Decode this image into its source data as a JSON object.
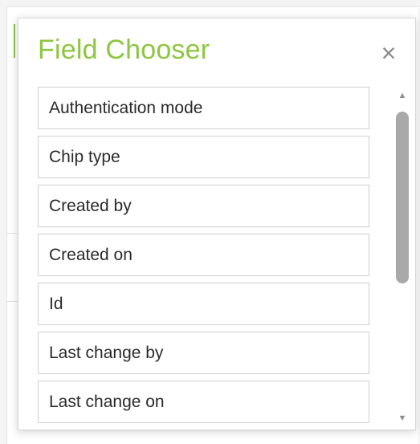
{
  "dialog": {
    "title": "Field Chooser",
    "close_glyph": "×",
    "accent_color": "#8dc63f"
  },
  "fields": [
    {
      "label": "Authentication mode"
    },
    {
      "label": "Chip type"
    },
    {
      "label": "Created by"
    },
    {
      "label": "Created on"
    },
    {
      "label": "Id"
    },
    {
      "label": "Last change by"
    },
    {
      "label": "Last change on"
    }
  ],
  "scrollbar": {
    "up_glyph": "▲",
    "down_glyph": "▼",
    "thumb_color": "#a9a9a9"
  }
}
